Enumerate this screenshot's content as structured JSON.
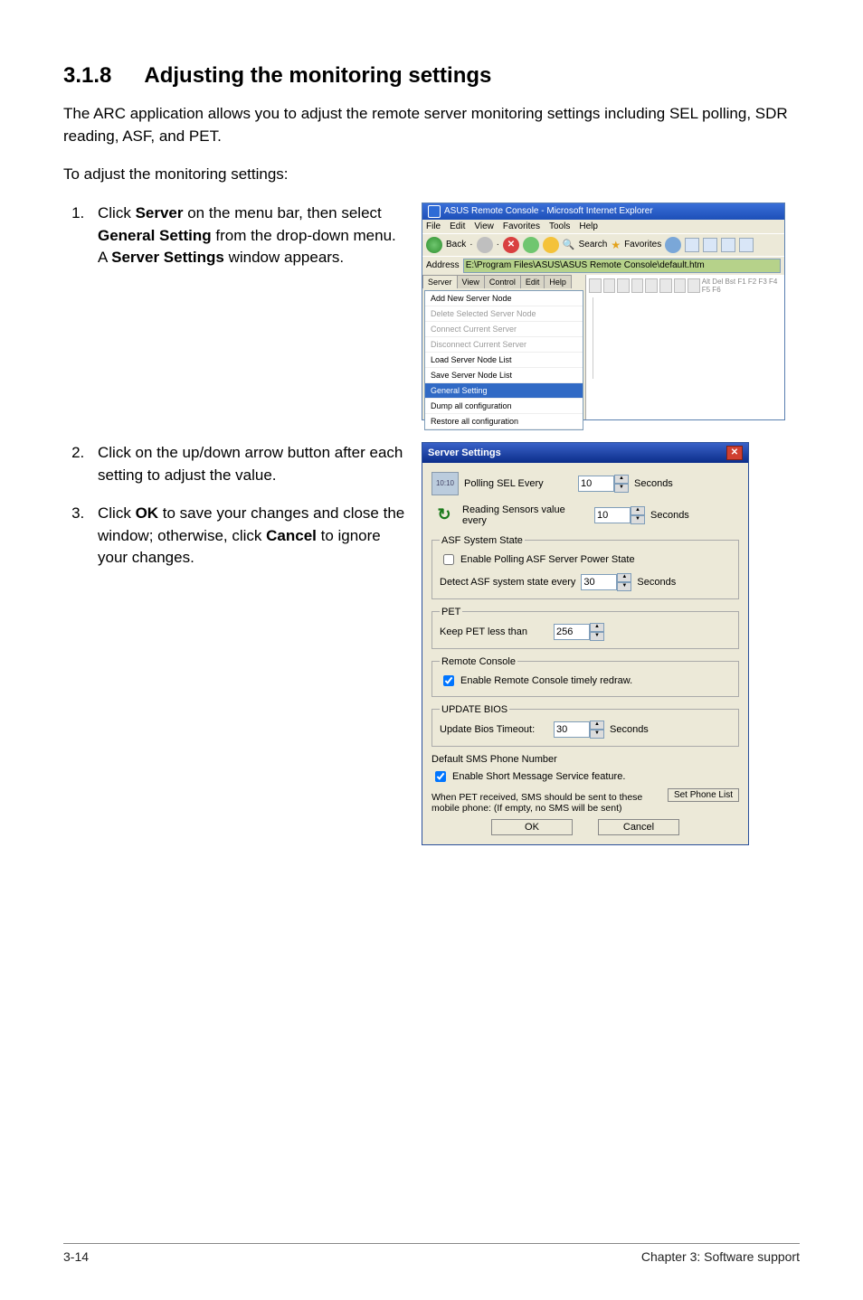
{
  "heading": {
    "number": "3.1.8",
    "title": "Adjusting the monitoring settings"
  },
  "intro": "The ARC application allows you to adjust the remote server monitoring settings including SEL polling, SDR reading, ASF, and PET.",
  "lead": "To adjust the monitoring settings:",
  "steps": {
    "s1a": "Click ",
    "s1b": "Server",
    "s1c": " on the menu bar, then select ",
    "s1d": "General Setting",
    "s1e": " from the drop-down menu. A ",
    "s1f": "Server Settings",
    "s1g": " window appears.",
    "s2": "Click on the up/down arrow button after each setting to adjust the value.",
    "s3a": "Click ",
    "s3b": "OK",
    "s3c": " to save your changes and close the window; otherwise, click ",
    "s3d": "Cancel",
    "s3e": " to ignore your changes."
  },
  "footer": {
    "left": "3-14",
    "right": "Chapter 3: Software support"
  },
  "ie": {
    "title": "ASUS Remote Console - Microsoft Internet Explorer",
    "menubar": {
      "file": "File",
      "edit": "Edit",
      "view": "View",
      "fav": "Favorites",
      "tools": "Tools",
      "help": "Help"
    },
    "toolbar": {
      "back": "Back",
      "search": "Search",
      "favorites": "Favorites"
    },
    "addr_label": "Address",
    "addr_value": "E:\\Program Files\\ASUS\\ASUS Remote Console\\default.htm",
    "tabs": {
      "server": "Server",
      "view": "View",
      "control": "Control",
      "edit": "Edit",
      "help": "Help"
    },
    "srv_menu": {
      "add": "Add New Server Node",
      "del": "Delete Selected Server Node",
      "conn": "Connect Current Server",
      "disc": "Disconnect Current Server",
      "load": "Load Server Node List",
      "save": "Save Server Node List",
      "gen": "General Setting",
      "dump": "Dump all configuration",
      "rest": "Restore all configuration"
    },
    "right_tb": "Alt  Del  Bst  F1  F2  F3  F4  F5  F6"
  },
  "ss": {
    "title": "Server Settings",
    "poll_label": "Polling SEL Every",
    "poll_value": "10",
    "seconds": "Seconds",
    "read_label": "Reading Sensors value every",
    "read_value": "10",
    "asf": {
      "legend": "ASF System State",
      "chk": "Enable Polling ASF Server Power State",
      "detect": "Detect ASF system state every",
      "detect_val": "30"
    },
    "pet": {
      "legend": "PET",
      "keep": "Keep PET less than",
      "keep_val": "256"
    },
    "rc": {
      "legend": "Remote Console",
      "chk": "Enable Remote Console timely redraw."
    },
    "ub": {
      "legend": "UPDATE BIOS",
      "label": "Update Bios Timeout:",
      "val": "30"
    },
    "sms": {
      "head": "Default SMS Phone Number",
      "chk": "Enable Short Message Service feature.",
      "when": "When PET received, SMS should be sent to these mobile phone: (If empty, no SMS will be sent)",
      "btn": "Set Phone List"
    },
    "ok": "OK",
    "cancel": "Cancel"
  }
}
